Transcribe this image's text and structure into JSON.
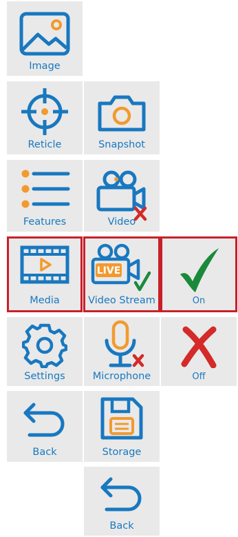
{
  "colors": {
    "tile_bg": "#e9e9e9",
    "icon_blue": "#1878c0",
    "accent_orange": "#f29a2e",
    "check_green": "#1a8a3a",
    "cross_red": "#d42a2a",
    "selection_border": "#c8202a"
  },
  "menu": {
    "col1": [
      {
        "label": "Image",
        "icon": "image-icon"
      },
      {
        "label": "Reticle",
        "icon": "reticle-icon"
      },
      {
        "label": "Features",
        "icon": "list-icon"
      },
      {
        "label": "Media",
        "icon": "media-film-icon",
        "selected": true
      },
      {
        "label": "Settings",
        "icon": "gear-icon"
      },
      {
        "label": "Back",
        "icon": "back-arrow-icon"
      }
    ],
    "col2": [
      {
        "label": "Snapshot",
        "icon": "camera-icon"
      },
      {
        "label": "Video",
        "icon": "video-camera-off-icon"
      },
      {
        "label": "Video Stream",
        "icon": "live-stream-on-icon",
        "selected": true
      },
      {
        "label": "Microphone",
        "icon": "microphone-off-icon"
      },
      {
        "label": "Storage",
        "icon": "save-disk-icon"
      },
      {
        "label": "Back",
        "icon": "back-arrow-icon"
      }
    ],
    "col3": [
      {
        "label": "On",
        "icon": "checkmark-icon",
        "selected": true
      },
      {
        "label": "Off",
        "icon": "cross-icon"
      }
    ]
  }
}
